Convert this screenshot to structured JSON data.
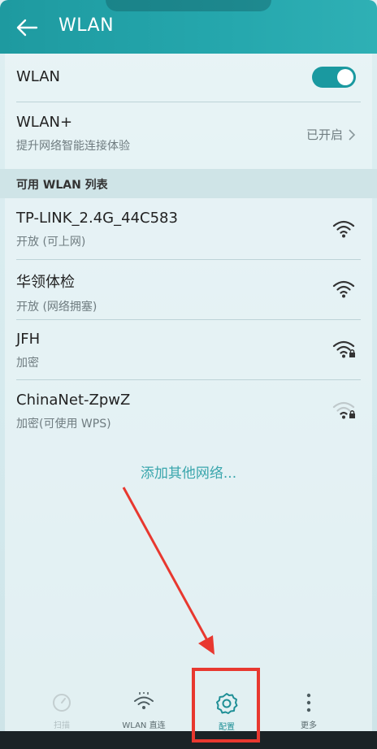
{
  "app_bar": {
    "title": "WLAN"
  },
  "wlan_toggle": {
    "label": "WLAN",
    "state": "on"
  },
  "wlan_plus": {
    "label": "WLAN+",
    "subtitle": "提升网络智能连接体验",
    "status": "已开启"
  },
  "section": {
    "header": "可用 WLAN 列表"
  },
  "networks": [
    {
      "name": "TP-LINK_2.4G_44C583",
      "status": "开放 (可上网)",
      "icon": "wifi-open-icon"
    },
    {
      "name": "华领体检",
      "status": "开放 (网络拥塞)",
      "icon": "wifi-open-icon"
    },
    {
      "name": "JFH",
      "status": "加密",
      "icon": "wifi-locked-icon"
    },
    {
      "name": "ChinaNet-ZpwZ",
      "status": "加密(可使用 WPS)",
      "icon": "wifi-locked-weak-icon"
    }
  ],
  "add_network": {
    "label": "添加其他网络..."
  },
  "bottom_tabs": [
    {
      "label": "扫描",
      "icon": "refresh-icon",
      "state": "disabled"
    },
    {
      "label": "WLAN 直连",
      "icon": "wifi-direct-icon",
      "state": "normal"
    },
    {
      "label": "配置",
      "icon": "gear-icon",
      "state": "highlighted"
    },
    {
      "label": "更多",
      "icon": "more-vertical-icon",
      "state": "normal"
    }
  ],
  "colors": {
    "accent": "#1a99a0",
    "annotation": "#e8382f"
  }
}
